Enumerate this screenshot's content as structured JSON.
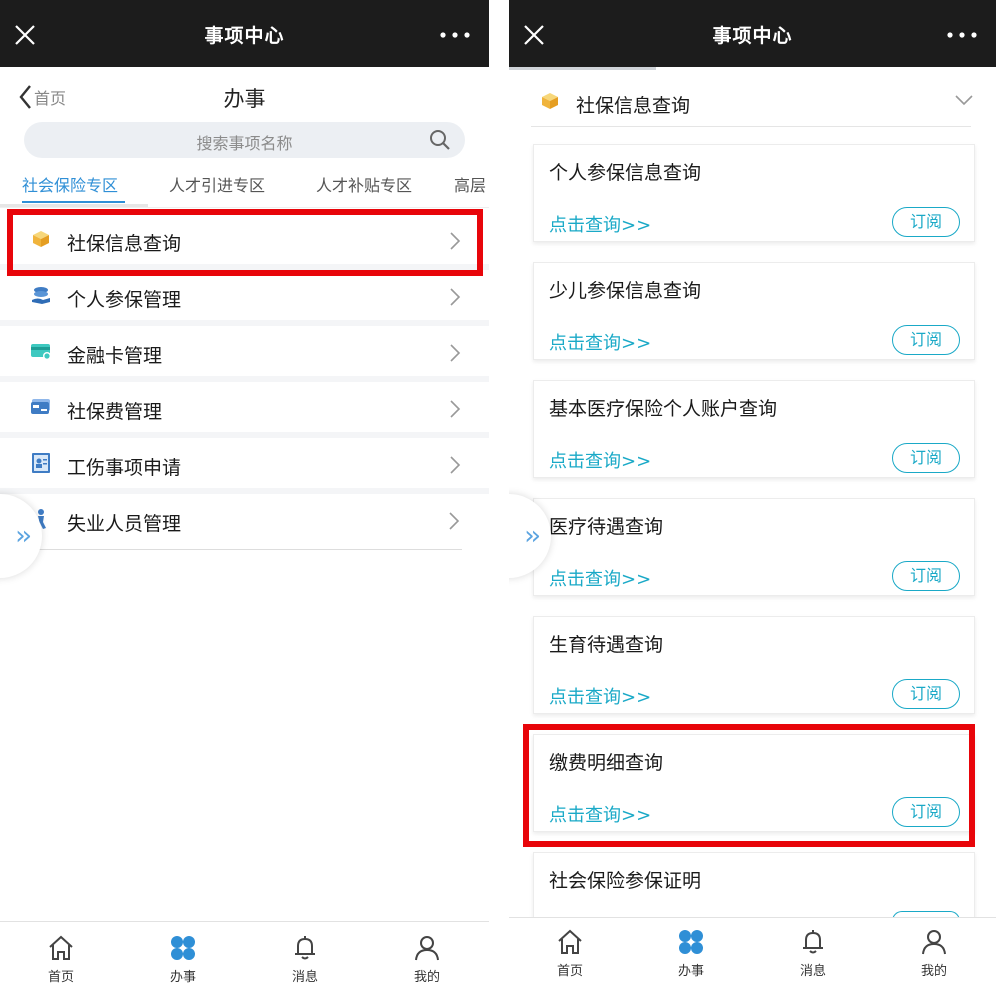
{
  "left": {
    "topbar": {
      "title": "事项中心"
    },
    "subheader": {
      "back_label": "首页",
      "title": "办事"
    },
    "search": {
      "placeholder": "搜索事项名称"
    },
    "tabs": [
      "社会保险专区",
      "人才引进专区",
      "人才补贴专区",
      "高层"
    ],
    "menu": [
      {
        "label": "社保信息查询",
        "icon": "box-icon"
      },
      {
        "label": "个人参保管理",
        "icon": "coins-hand-icon"
      },
      {
        "label": "金融卡管理",
        "icon": "card-icon"
      },
      {
        "label": "社保费管理",
        "icon": "payment-card-icon"
      },
      {
        "label": "工伤事项申请",
        "icon": "id-card-icon"
      },
      {
        "label": "失业人员管理",
        "icon": "person-icon"
      }
    ],
    "bottom_nav": [
      "首页",
      "办事",
      "消息",
      "我的"
    ]
  },
  "right": {
    "topbar": {
      "title": "事项中心"
    },
    "section": {
      "title": "社保信息查询"
    },
    "cards": [
      {
        "title": "个人参保信息查询",
        "link": "点击查询>>",
        "subscribe": "订阅"
      },
      {
        "title": "少儿参保信息查询",
        "link": "点击查询>>",
        "subscribe": "订阅"
      },
      {
        "title": "基本医疗保险个人账户查询",
        "link": "点击查询>>",
        "subscribe": "订阅"
      },
      {
        "title": "医疗待遇查询",
        "link": "点击查询>>",
        "subscribe": "订阅"
      },
      {
        "title": "生育待遇查询",
        "link": "点击查询>>",
        "subscribe": "订阅"
      },
      {
        "title": "缴费明细查询",
        "link": "点击查询>>",
        "subscribe": "订阅"
      },
      {
        "title": "社会保险参保证明",
        "link": "",
        "subscribe": ""
      }
    ],
    "bottom_nav": [
      "首页",
      "办事",
      "消息",
      "我的"
    ]
  },
  "colors": {
    "accent": "#2f8fd6",
    "link": "#1aa9c7",
    "highlight": "#e8050a",
    "topbar": "#1c1c1c"
  }
}
